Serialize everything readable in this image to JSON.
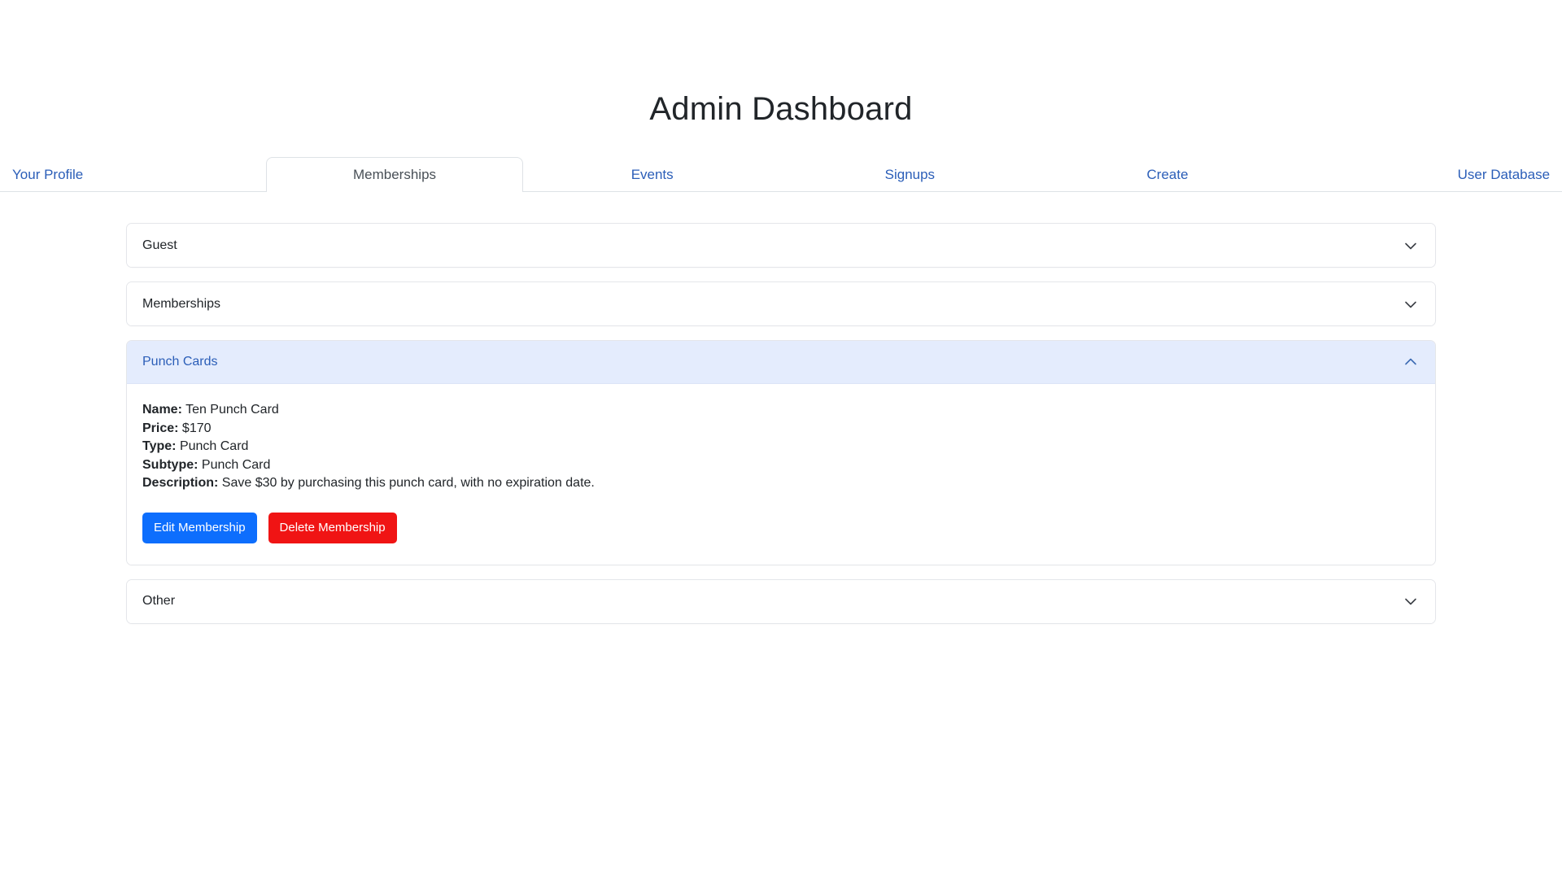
{
  "header": {
    "title": "Admin Dashboard"
  },
  "tabs": [
    {
      "label": "Your Profile",
      "active": false,
      "name": "tab-your-profile"
    },
    {
      "label": "Memberships",
      "active": true,
      "name": "tab-memberships"
    },
    {
      "label": "Events",
      "active": false,
      "name": "tab-events"
    },
    {
      "label": "Signups",
      "active": false,
      "name": "tab-signups"
    },
    {
      "label": "Create",
      "active": false,
      "name": "tab-create"
    },
    {
      "label": "User Database",
      "active": false,
      "name": "tab-user-database"
    }
  ],
  "accordion": {
    "sections": [
      {
        "title": "Guest",
        "name": "accordion-section-guest",
        "expanded": false,
        "chevron": "chevron-down-icon"
      },
      {
        "title": "Memberships",
        "name": "accordion-section-memberships",
        "expanded": false,
        "chevron": "chevron-down-icon"
      },
      {
        "title": "Punch Cards",
        "name": "accordion-section-punch-cards",
        "expanded": true,
        "chevron": "chevron-up-icon",
        "details": [
          {
            "label": "Name:",
            "value": "Ten Punch Card"
          },
          {
            "label": "Price:",
            "value": "$170"
          },
          {
            "label": "Type:",
            "value": "Punch Card"
          },
          {
            "label": "Subtype:",
            "value": "Punch Card"
          },
          {
            "label": "Description:",
            "value": "Save $30 by purchasing this punch card, with no expiration date."
          }
        ],
        "buttons": [
          {
            "label": "Edit Membership",
            "style": "edit",
            "name": "edit-membership-button"
          },
          {
            "label": "Delete Membership",
            "style": "delete",
            "name": "delete-membership-button"
          }
        ]
      },
      {
        "title": "Other",
        "name": "accordion-section-other",
        "expanded": false,
        "chevron": "chevron-down-icon"
      }
    ]
  },
  "colors": {
    "link": "#2b5eb8",
    "active_header_bg": "#e4ecfd",
    "edit_button": "#0d6efd",
    "delete_button": "#f01414",
    "border": "#dee2e6",
    "text": "#212529"
  }
}
